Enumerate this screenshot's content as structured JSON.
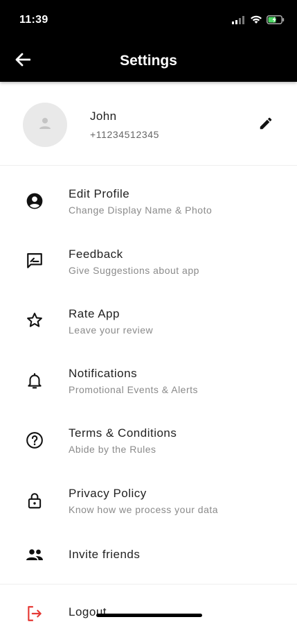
{
  "status_bar": {
    "time": "11:39"
  },
  "app_bar": {
    "title": "Settings",
    "background": "#000000"
  },
  "profile": {
    "name": "John",
    "phone": "+11234512345"
  },
  "menu": [
    {
      "label": "Edit Profile",
      "subtitle": "Change Display Name & Photo",
      "icon": "account-circle-icon"
    },
    {
      "label": "Feedback",
      "subtitle": "Give Suggestions about app",
      "icon": "feedback-icon"
    },
    {
      "label": "Rate App",
      "subtitle": "Leave your review",
      "icon": "star-outline-icon"
    },
    {
      "label": "Notifications",
      "subtitle": "Promotional Events & Alerts",
      "icon": "bell-icon"
    },
    {
      "label": "Terms & Conditions",
      "subtitle": "Abide by the Rules",
      "icon": "help-circle-icon"
    },
    {
      "label": "Privacy Policy",
      "subtitle": "Know how we process your data",
      "icon": "lock-icon"
    },
    {
      "label": "Invite friends",
      "icon": "people-icon"
    },
    {
      "label": "Logout",
      "icon": "logout-icon",
      "icon_color": "#e53935"
    }
  ]
}
